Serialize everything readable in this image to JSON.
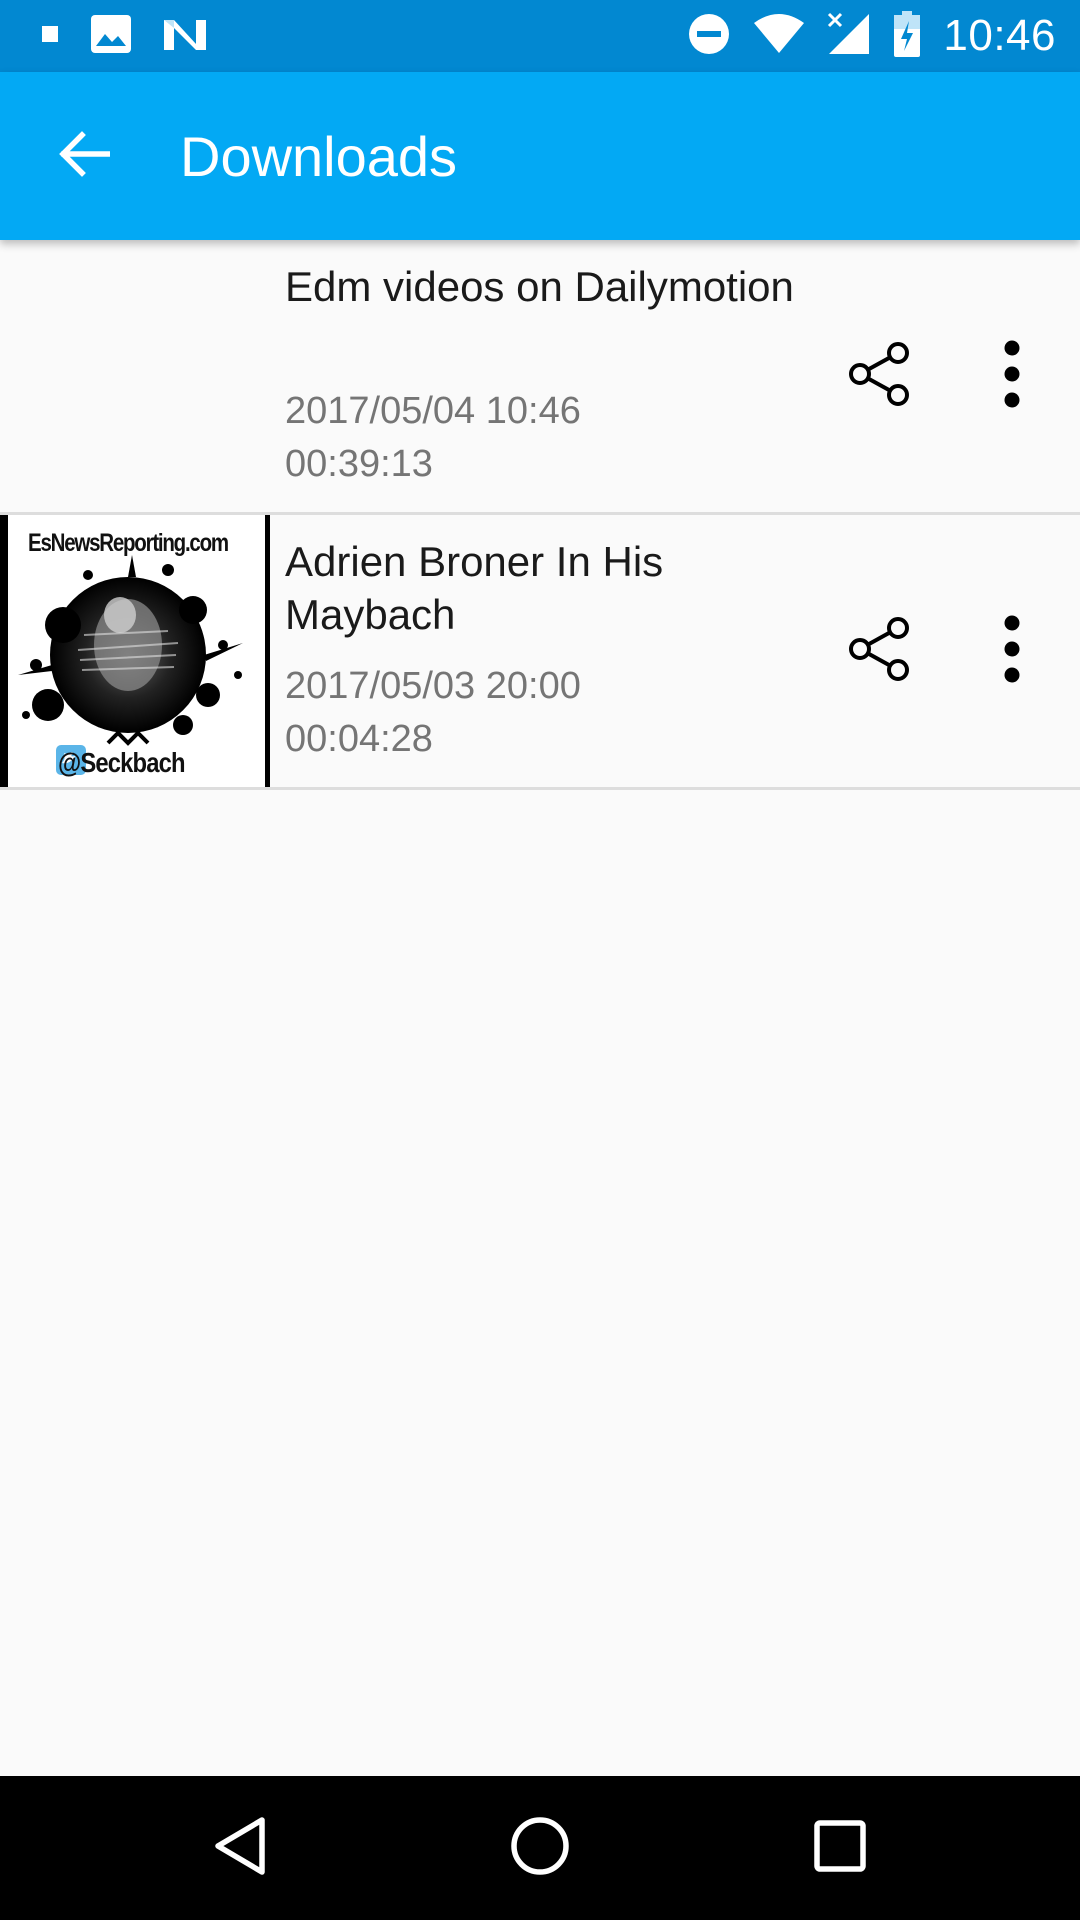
{
  "status_bar": {
    "time": "10:46",
    "left_icons": [
      "stop-square-icon",
      "image-notification-icon",
      "n-logo-icon"
    ],
    "right_icons": [
      "do-not-disturb-icon",
      "wifi-icon",
      "signal-no-data-icon",
      "battery-charging-icon"
    ]
  },
  "app_bar": {
    "title": "Downloads",
    "back_icon": "arrow-back-icon"
  },
  "downloads": [
    {
      "title": "Edm videos on Dailymotion",
      "date": "2017/05/04 10:46",
      "duration": "00:39:13",
      "has_thumbnail": false
    },
    {
      "title": "Adrien Broner In His Maybach",
      "date": "2017/05/03 20:00",
      "duration": "00:04:28",
      "has_thumbnail": true,
      "thumbnail_text": {
        "site": "EsNewsReporting.com",
        "handle": "@Seckbach"
      }
    }
  ],
  "nav_bar": {
    "buttons": [
      "back-triangle-icon",
      "home-circle-icon",
      "recents-square-icon"
    ]
  },
  "colors": {
    "status_bar": "#0288d1",
    "app_bar": "#03a9f4",
    "background": "#fafafa",
    "secondary_text": "#757575"
  }
}
